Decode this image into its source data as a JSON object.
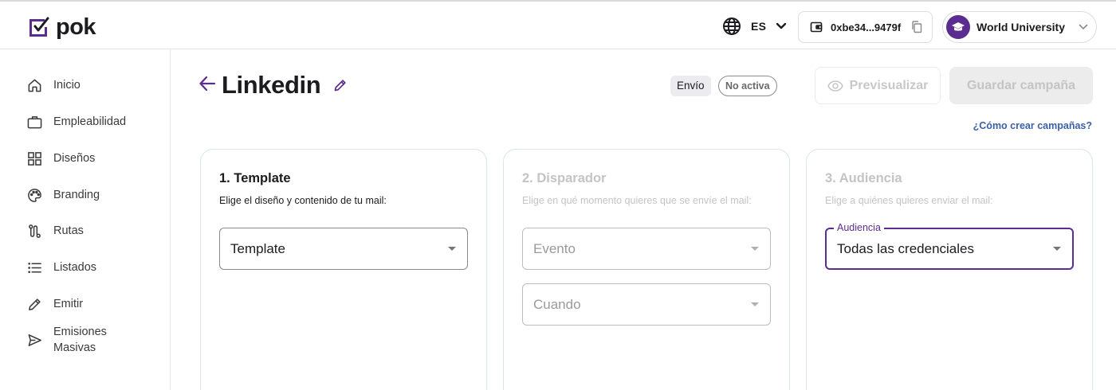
{
  "brand": {
    "name": "pok",
    "accent": "#5b2d90"
  },
  "header": {
    "language_code": "ES",
    "wallet_address": "0xbe34...9479f",
    "account_name": "World University"
  },
  "sidebar": {
    "items": [
      {
        "label": "Inicio",
        "icon": "home-icon"
      },
      {
        "label": "Empleabilidad",
        "icon": "briefcase-icon"
      },
      {
        "label": "Diseños",
        "icon": "grid-icon"
      },
      {
        "label": "Branding",
        "icon": "palette-icon"
      },
      {
        "label": "Rutas",
        "icon": "route-icon"
      },
      {
        "label": "Listados",
        "icon": "list-icon"
      },
      {
        "label": "Emitir",
        "icon": "pencil-icon"
      },
      {
        "label": "Emisiones\nMasivas",
        "icon": "send-icon"
      }
    ]
  },
  "page": {
    "title": "Linkedin",
    "type_chip": "Envío",
    "status_chip": "No activa",
    "preview_label": "Previsualizar",
    "save_label": "Guardar campaña",
    "help_link": "¿Cómo crear campañas?"
  },
  "steps": {
    "template": {
      "title": "1. Template",
      "description": "Elige el diseño y contenido de tu mail:",
      "select_value": "Template"
    },
    "trigger": {
      "title": "2. Disparador",
      "description": "Elige en qué momento quieres que se envíe el mail:",
      "event_value": "Evento",
      "when_value": "Cuando"
    },
    "audience": {
      "title": "3. Audiencia",
      "description": "Elige a quiénes quieres enviar el mail:",
      "label": "Audiencia",
      "select_value": "Todas las credenciales"
    }
  }
}
